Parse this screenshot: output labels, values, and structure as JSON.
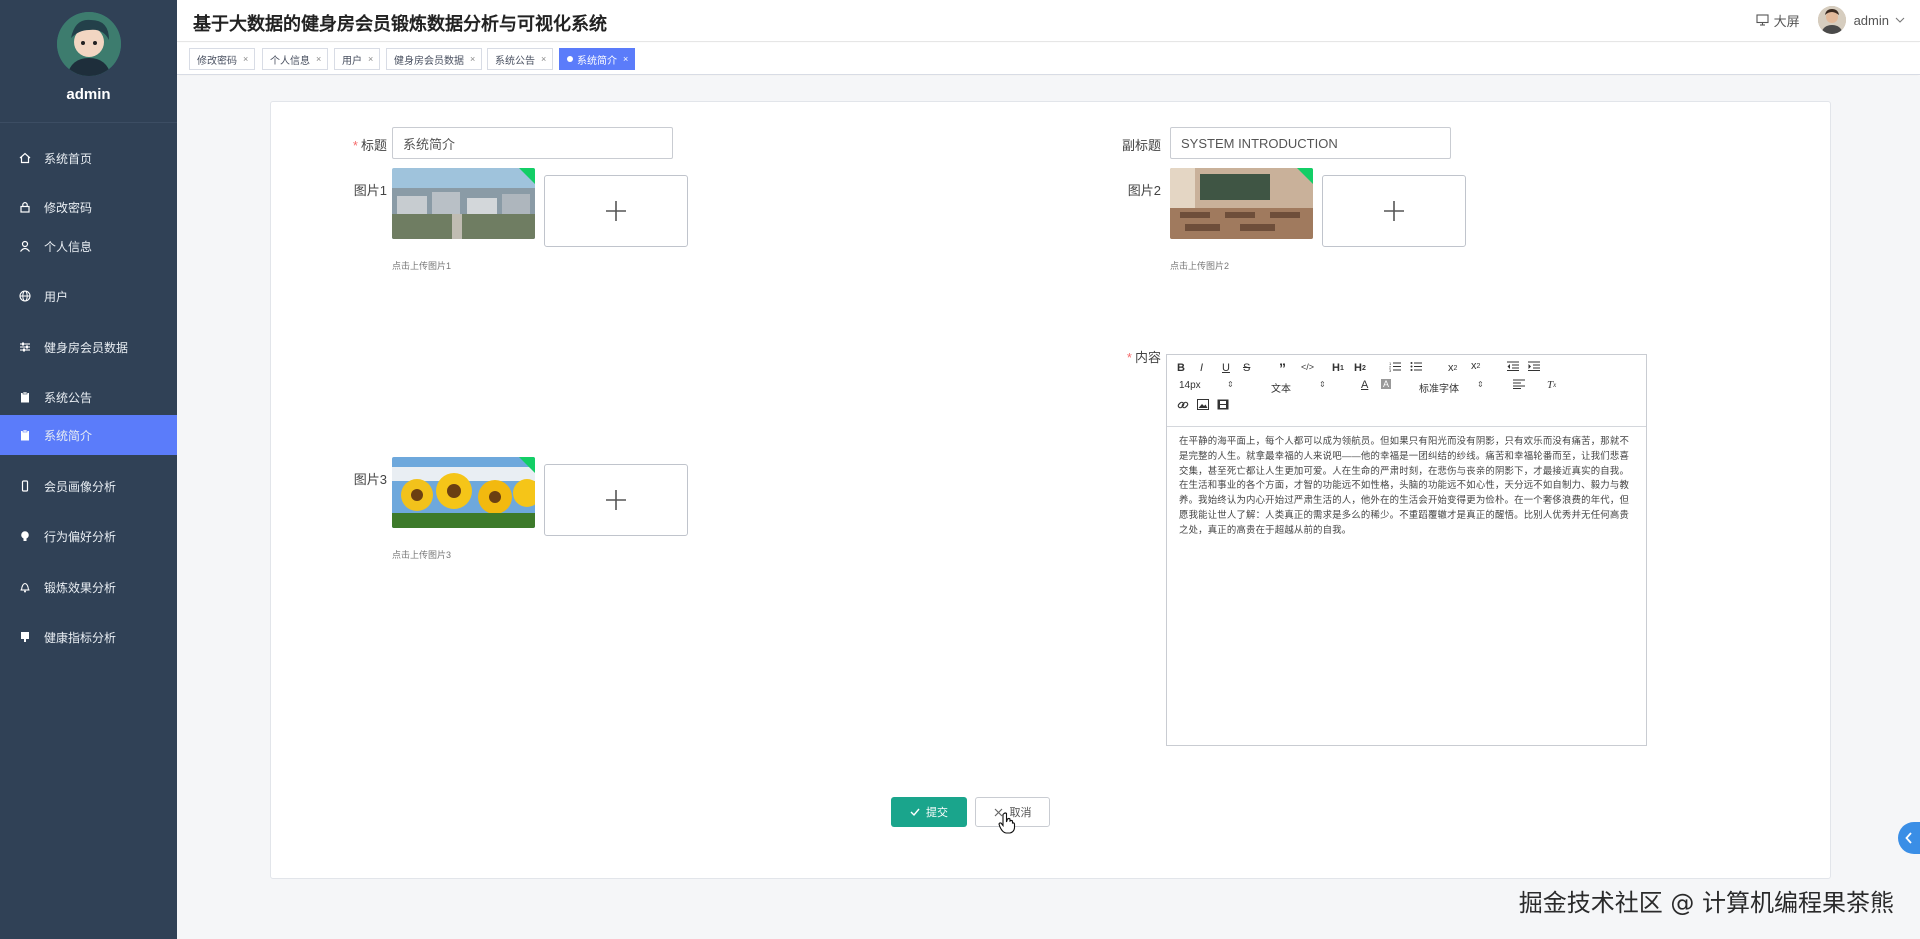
{
  "sidebar": {
    "username": "admin",
    "items": [
      {
        "label": "系统首页",
        "icon": "home-icon"
      },
      {
        "label": "修改密码",
        "icon": "lock-icon"
      },
      {
        "label": "个人信息",
        "icon": "user-icon"
      },
      {
        "label": "用户",
        "icon": "globe-icon"
      },
      {
        "label": "健身房会员数据",
        "icon": "sliders-icon"
      },
      {
        "label": "系统公告",
        "icon": "clipboard-icon"
      },
      {
        "label": "系统简介",
        "icon": "clipboard-icon"
      },
      {
        "label": "会员画像分析",
        "icon": "phone-icon"
      },
      {
        "label": "行为偏好分析",
        "icon": "bulb-icon"
      },
      {
        "label": "锻炼效果分析",
        "icon": "bell-icon"
      },
      {
        "label": "健康指标分析",
        "icon": "chart-icon"
      }
    ],
    "active_index": 6
  },
  "header": {
    "title": "基于大数据的健身房会员锻炼数据分析与可视化系统",
    "screen_label": "大屏",
    "user_label": "admin"
  },
  "tags": [
    {
      "label": "修改密码"
    },
    {
      "label": "个人信息"
    },
    {
      "label": "用户"
    },
    {
      "label": "健身房会员数据"
    },
    {
      "label": "系统公告"
    },
    {
      "label": "系统简介",
      "active": true
    }
  ],
  "form": {
    "title_label": "标题",
    "title_value": "系统简介",
    "subtitle_label": "副标题",
    "subtitle_value": "SYSTEM INTRODUCTION",
    "pic1_label": "图片1",
    "pic1_hint": "点击上传图片1",
    "pic2_label": "图片2",
    "pic2_hint": "点击上传图片2",
    "pic3_label": "图片3",
    "pic3_hint": "点击上传图片3",
    "content_label": "内容",
    "editor": {
      "font_size": "14px",
      "header_select": "文本",
      "font_select": "标准字体",
      "content": "在平静的海平面上，每个人都可以成为领航员。但如果只有阳光而没有阴影，只有欢乐而没有痛苦，那就不是完整的人生。就拿最幸福的人来说吧——他的幸福是一团纠结的纱线。痛苦和幸福轮番而至，让我们悲喜交集，甚至死亡都让人生更加可爱。人在生命的严肃时刻，在悲伤与丧亲的阴影下，才最接近真实的自我。在生活和事业的各个方面，才智的功能远不如性格，头脑的功能远不如心性，天分远不如自制力、毅力与教养。我始终认为内心开始过严肃生活的人，他外在的生活会开始变得更为俭朴。在一个奢侈浪费的年代，但愿我能让世人了解：人类真正的需求是多么的稀少。不重蹈覆辙才是真正的醒悟。比别人优秀并无任何高贵之处，真正的高贵在于超越从前的自我。"
    },
    "submit_label": "提交",
    "cancel_label": "取消"
  },
  "watermark": "掘金技术社区 @ 计算机编程果茶熊",
  "colors": {
    "sidebar_bg": "#304156",
    "active_blue": "#5b7cfa",
    "submit_green": "#1aa58c",
    "required_red": "#f56c6c"
  }
}
